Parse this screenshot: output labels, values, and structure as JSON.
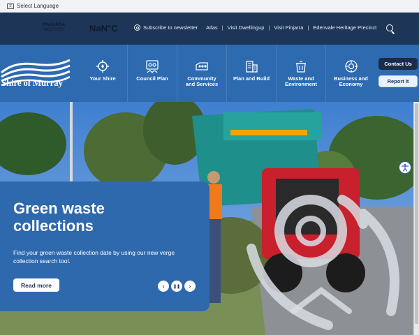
{
  "language": {
    "label": "Select Language",
    "icon": "translate-icon"
  },
  "weather": {
    "line1": "PINJARRA",
    "line2": "WEATHER",
    "temperature": "NaN°C"
  },
  "utility_nav": {
    "subscribe": "Subscribe to newsletter",
    "links": [
      "Atlas",
      "Visit Dwellingup",
      "Visit Pinjarra",
      "Edenvale Heritage Precinct"
    ]
  },
  "brand": {
    "name": "Shire of Murray",
    "color": "#2d6ab0",
    "dark": "#1d3557"
  },
  "main_nav": {
    "items": [
      {
        "label": "Your Shire",
        "icon": "compass-icon"
      },
      {
        "label": "Council Plan",
        "icon": "people-icon"
      },
      {
        "label": "Community\nand Services",
        "icon": "community-icon"
      },
      {
        "label": "Plan and Build",
        "icon": "building-icon"
      },
      {
        "label": "Waste and\nEnvironment",
        "icon": "bin-icon"
      },
      {
        "label": "Business and\nEconomy",
        "icon": "business-icon"
      }
    ],
    "contact": "Contact Us",
    "report": "Report It"
  },
  "hero": {
    "title": "Green waste collections",
    "description": "Find your green waste collection date by using our new verge collection search tool.",
    "button": "Read more",
    "controls": {
      "prev": "‹",
      "pause": "❚❚",
      "next": "›"
    }
  }
}
